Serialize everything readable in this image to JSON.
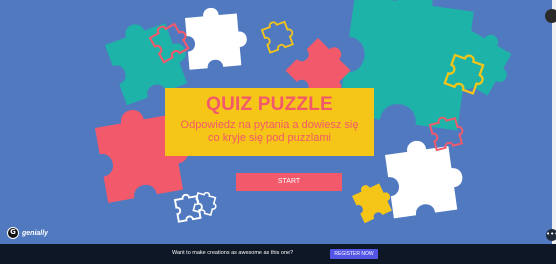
{
  "colors": {
    "background": "#5079c0",
    "card": "#f5c518",
    "accent": "#f2596b",
    "footer": "#0d1726",
    "register_button": "#5454e6",
    "puzzle_teal": "#1eb3a8",
    "puzzle_pink": "#f2596b",
    "puzzle_yellow": "#f5c518",
    "puzzle_white": "#ffffff"
  },
  "quiz": {
    "title": "QUIZ PUZZLE",
    "subtitle_line1": "Odpowiedz na pytania a dowiesz się",
    "subtitle_line2": "co kryje się pod puzzlami",
    "start_label": "START"
  },
  "branding": {
    "logo_text": "genially",
    "logo_icon": "genially-logo-icon"
  },
  "footer": {
    "promo_text": "Want to make creations as awesome as this one?",
    "register_label": "REGISTER NOW"
  },
  "controls": {
    "top_icon": "chevron-up-icon",
    "side_icon": "more-options-icon",
    "side_glyph": "•••"
  }
}
